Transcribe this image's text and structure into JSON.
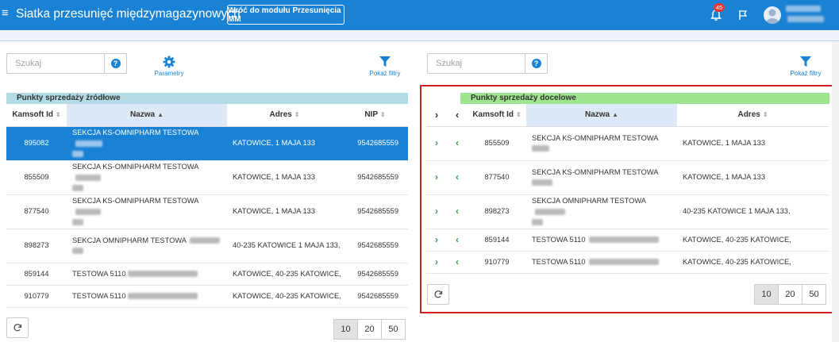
{
  "header": {
    "title": "Siatka przesunięć międzymagazynowych",
    "back_button": "Wróć do modułu Przesunięcia MM",
    "notification_count": "45"
  },
  "colors": {
    "primary": "#1a82d4",
    "source_caption": "#b2dbe6",
    "target_caption": "#9fe58f",
    "highlight_frame": "#cc1f1f",
    "arrow": "#2f9e44"
  },
  "left": {
    "search_placeholder": "Szukaj",
    "params_label": "Parametry",
    "filter_label": "Pokaż filtry",
    "caption": "Punkty sprzedaży źródłowe",
    "columns": [
      "Kamsoft Id",
      "Nazwa",
      "Adres",
      "NIP"
    ],
    "rows": [
      {
        "id": "895082",
        "name": "SEKCJA KS-OMNIPHARM TESTOWA",
        "name2": "",
        "address": "KATOWICE, 1 MAJA 133",
        "nip": "9542685559"
      },
      {
        "id": "855509",
        "name": "SEKCJA KS-OMNIPHARM TESTOWA",
        "name2": "",
        "address": "KATOWICE, 1 MAJA 133",
        "nip": "9542685559"
      },
      {
        "id": "877540",
        "name": "SEKCJA KS-OMNIPHARM TESTOWA",
        "name2": "",
        "address": "KATOWICE, 1 MAJA 133",
        "nip": "9542685559"
      },
      {
        "id": "898273",
        "name": "SEKCJA OMNIPHARM TESTOWA",
        "name2": "",
        "address": "40-235 KATOWICE 1 MAJA 133,",
        "nip": "9542685559"
      },
      {
        "id": "859144",
        "name": "TESTOWA 5110",
        "name2": "",
        "address": "KATOWICE, 40-235 KATOWICE,",
        "nip": "9542685559"
      },
      {
        "id": "910779",
        "name": "TESTOWA 5110",
        "name2": "",
        "address": "KATOWICE, 40-235 KATOWICE,",
        "nip": "9542685559"
      }
    ],
    "page_sizes": [
      "10",
      "20",
      "50"
    ]
  },
  "right": {
    "search_placeholder": "Szukaj",
    "filter_label": "Pokaż filtry",
    "caption": "Punkty sprzedaży docelowe",
    "columns": [
      "Kamsoft Id",
      "Nazwa",
      "Adres"
    ],
    "rows": [
      {
        "id": "855509",
        "name": "SEKCJA KS-OMNIPHARM TESTOWA",
        "address": "KATOWICE, 1 MAJA 133"
      },
      {
        "id": "877540",
        "name": "SEKCJA KS-OMNIPHARM TESTOWA",
        "address": "KATOWICE, 1 MAJA 133"
      },
      {
        "id": "898273",
        "name": "SEKCJA OMNIPHARM TESTOWA",
        "address": "40-235 KATOWICE 1 MAJA 133,"
      },
      {
        "id": "859144",
        "name": "TESTOWA 5110",
        "address": "KATOWICE, 40-235 KATOWICE,"
      },
      {
        "id": "910779",
        "name": "TESTOWA 5110",
        "address": "KATOWICE, 40-235 KATOWICE,"
      }
    ],
    "page_sizes": [
      "10",
      "20",
      "50"
    ]
  }
}
